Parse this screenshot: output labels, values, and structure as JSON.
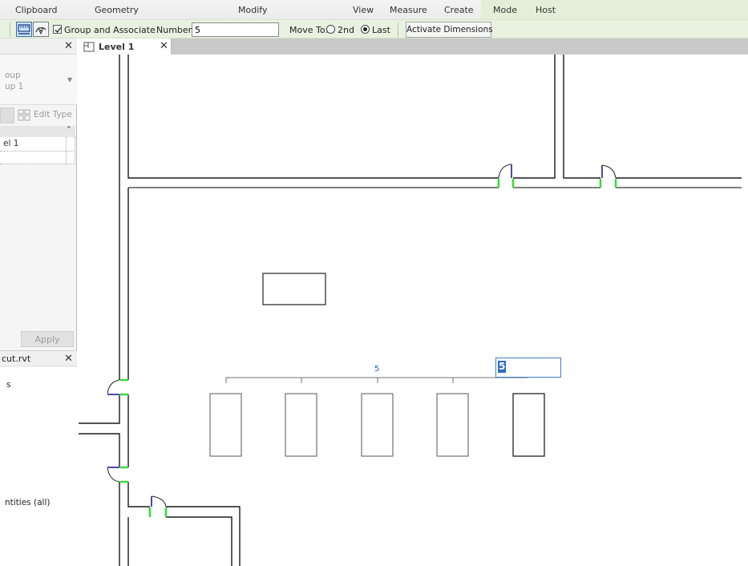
{
  "ribbon": {
    "panels": [
      "Clipboard",
      "Geometry",
      "Modify",
      "View",
      "Measure",
      "Create",
      "Mode",
      "Host"
    ]
  },
  "options_bar": {
    "group_and_associate": {
      "label": "Group and Associate",
      "checked": true
    },
    "number_label": "Number:",
    "number_value": "5",
    "move_to_label": "Move To:",
    "move_to_options": [
      {
        "label": "2nd",
        "selected": false
      },
      {
        "label": "Last",
        "selected": true
      }
    ],
    "activate_dimensions": "Activate Dimensions"
  },
  "properties_panel": {
    "type_line1": "oup",
    "type_line2": "up 1",
    "edit_type": "Edit Type",
    "param_value": "el 1",
    "apply": "Apply"
  },
  "project_browser": {
    "title": "cut.rvt",
    "items": [
      "s",
      "ntities (all)"
    ]
  },
  "view_tab": {
    "label": "Level 1"
  },
  "canvas": {
    "array_dimension_label": "5",
    "array_count_edit_value": "5",
    "colors": {
      "wall": "#1a1a1a",
      "door_panel": "#4a4aa8",
      "door_jamb": "#33dd33",
      "dimension": "#707070",
      "edit_border": "#3d7ec8",
      "selection": "#2d6fc0"
    }
  }
}
